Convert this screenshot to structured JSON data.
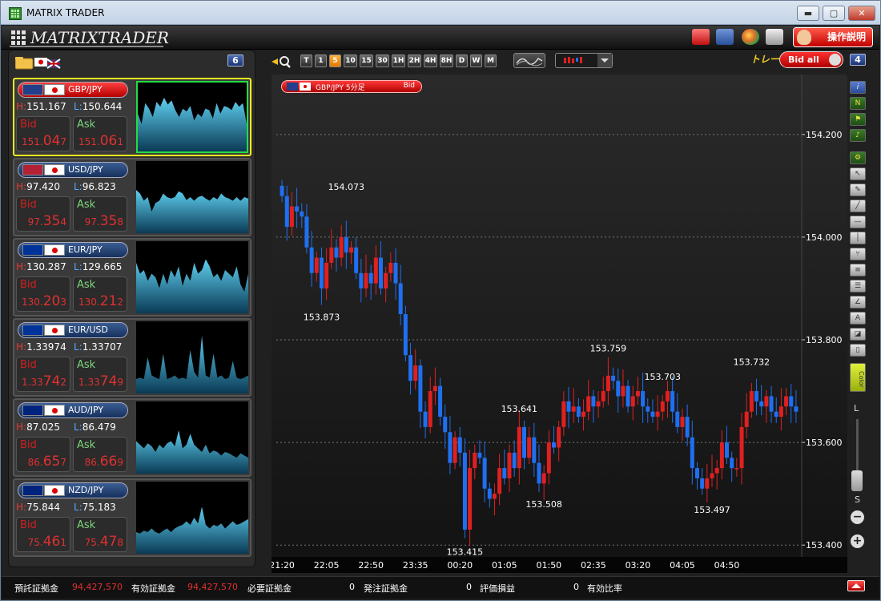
{
  "window": {
    "title": "MATRIX TRADER",
    "minimize": "▬",
    "maximize": "▢",
    "close": "✕"
  },
  "header": {
    "logo": "MATRIXTRADER",
    "help_label": "操作説明"
  },
  "left_panel": {
    "pair_count": "6"
  },
  "pairs": [
    {
      "name": "GBP/JPY",
      "high": "151.167",
      "low": "150.644",
      "bid_label": "Bid",
      "ask_label": "Ask",
      "bid_pre": "151.",
      "bid_big": "04",
      "bid_post": "7",
      "ask_pre": "151.",
      "ask_big": "06",
      "ask_post": "1",
      "f1": "#233e8a",
      "spark": [
        0.55,
        0.4,
        0.7,
        0.62,
        0.5,
        0.72,
        0.65,
        0.78,
        0.68,
        0.74,
        0.6,
        0.5,
        0.62,
        0.58,
        0.66,
        0.45,
        0.55,
        0.5,
        0.62,
        0.6,
        0.48,
        0.7,
        0.55,
        0.66,
        0.64,
        0.6,
        0.72,
        0.65,
        0.7,
        0.4
      ]
    },
    {
      "name": "USD/JPY",
      "high": "97.420",
      "low": "96.823",
      "bid_label": "Bid",
      "ask_label": "Ask",
      "bid_pre": "97.",
      "bid_big": "35",
      "bid_post": "4",
      "ask_pre": "97.",
      "ask_big": "35",
      "ask_post": "8",
      "f1": "#b22234",
      "spark": [
        0.6,
        0.55,
        0.45,
        0.5,
        0.3,
        0.42,
        0.45,
        0.55,
        0.5,
        0.48,
        0.5,
        0.58,
        0.55,
        0.46,
        0.5,
        0.45,
        0.5,
        0.52,
        0.48,
        0.45,
        0.5,
        0.47,
        0.55,
        0.5,
        0.48,
        0.45,
        0.5,
        0.45,
        0.5,
        0.48
      ]
    },
    {
      "name": "EUR/JPY",
      "high": "130.287",
      "low": "129.665",
      "bid_label": "Bid",
      "ask_label": "Ask",
      "bid_pre": "130.",
      "bid_big": "20",
      "bid_post": "3",
      "ask_pre": "130.",
      "ask_big": "21",
      "ask_post": "2",
      "f1": "#003399",
      "spark": [
        0.7,
        0.55,
        0.6,
        0.45,
        0.55,
        0.5,
        0.35,
        0.55,
        0.4,
        0.6,
        0.5,
        0.65,
        0.38,
        0.55,
        0.45,
        0.7,
        0.55,
        0.6,
        0.75,
        0.65,
        0.5,
        0.55,
        0.45,
        0.6,
        0.55,
        0.5,
        0.65,
        0.4,
        0.3,
        0.55
      ]
    },
    {
      "name": "EUR/USD",
      "high": "1.33974",
      "low": "1.33707",
      "bid_label": "Bid",
      "ask_label": "Ask",
      "bid_pre": "1.33",
      "bid_big": "74",
      "bid_post": "2",
      "ask_pre": "1.33",
      "ask_big": "74",
      "ask_post": "9",
      "f1": "#003399",
      "spark": [
        0.2,
        0.22,
        0.2,
        0.5,
        0.25,
        0.22,
        0.2,
        0.55,
        0.2,
        0.22,
        0.25,
        0.2,
        0.22,
        0.2,
        0.6,
        0.3,
        0.22,
        0.8,
        0.25,
        0.22,
        0.55,
        0.22,
        0.25,
        0.2,
        0.22,
        0.45,
        0.22,
        0.2,
        0.22,
        0.25
      ]
    },
    {
      "name": "AUD/JPY",
      "high": "87.025",
      "low": "86.479",
      "bid_label": "Bid",
      "ask_label": "Ask",
      "bid_pre": "86.",
      "bid_big": "65",
      "bid_post": "7",
      "ask_pre": "86.",
      "ask_big": "66",
      "ask_post": "9",
      "f1": "#00247d",
      "spark": [
        0.45,
        0.4,
        0.35,
        0.42,
        0.38,
        0.3,
        0.4,
        0.35,
        0.42,
        0.45,
        0.38,
        0.6,
        0.35,
        0.4,
        0.55,
        0.4,
        0.35,
        0.3,
        0.4,
        0.28,
        0.32,
        0.3,
        0.25,
        0.3,
        0.28,
        0.25,
        0.22,
        0.28,
        0.25,
        0.22
      ]
    },
    {
      "name": "NZD/JPY",
      "high": "75.844",
      "low": "75.183",
      "bid_label": "Bid",
      "ask_label": "Ask",
      "bid_pre": "75.",
      "bid_big": "46",
      "bid_post": "1",
      "ask_pre": "75.",
      "ask_big": "47",
      "ask_post": "8",
      "f1": "#00247d",
      "spark": [
        0.3,
        0.28,
        0.32,
        0.3,
        0.35,
        0.3,
        0.28,
        0.32,
        0.35,
        0.3,
        0.35,
        0.38,
        0.4,
        0.45,
        0.4,
        0.5,
        0.42,
        0.65,
        0.4,
        0.35,
        0.4,
        0.38,
        0.42,
        0.35,
        0.4,
        0.45,
        0.4,
        0.42,
        0.45,
        0.48
      ]
    }
  ],
  "toolbar": {
    "timeframes": [
      "T",
      "1",
      "5",
      "10",
      "15",
      "30",
      "1H",
      "2H",
      "4H",
      "8H",
      "D",
      "W",
      "M"
    ],
    "active_timeframe": "5",
    "trade_label": "トレード",
    "bid_all_label": "Bid all",
    "chart_count": "4"
  },
  "chart_label": {
    "pair": "GBP/JPY 5分足",
    "side": "Bid"
  },
  "chart_data": {
    "type": "candlestick",
    "title": "GBP/JPY 5分足",
    "y_ticks": [
      "154.200",
      "154.000",
      "153.800",
      "153.600",
      "153.400"
    ],
    "y_tick_values": [
      154.2,
      154.0,
      153.8,
      153.6,
      153.4
    ],
    "ylim": [
      153.38,
      154.27
    ],
    "x_ticks": [
      "21:20",
      "22:05",
      "22:50",
      "23:35",
      "00:20",
      "01:05",
      "01:50",
      "02:35",
      "03:20",
      "04:05",
      "04:50"
    ],
    "annotations": [
      {
        "label": "154.073",
        "value": 154.073,
        "index": 13
      },
      {
        "label": "153.873",
        "value": 153.873,
        "index": 8
      },
      {
        "label": "153.641",
        "value": 153.641,
        "index": 48
      },
      {
        "label": "153.508",
        "value": 153.508,
        "index": 53
      },
      {
        "label": "153.415",
        "value": 153.415,
        "index": 37
      },
      {
        "label": "153.759",
        "value": 153.759,
        "index": 66
      },
      {
        "label": "153.703",
        "value": 153.703,
        "index": 77
      },
      {
        "label": "153.497",
        "value": 153.497,
        "index": 87
      },
      {
        "label": "153.732",
        "value": 153.732,
        "index": 95
      }
    ],
    "up_color": "#e02020",
    "down_color": "#1f6ff0",
    "closes": [
      154.08,
      154.02,
      154.06,
      154.05,
      154.04,
      153.98,
      153.93,
      153.96,
      153.9,
      153.95,
      153.98,
      153.96,
      154.0,
      153.97,
      153.98,
      153.93,
      153.9,
      153.93,
      153.91,
      153.96,
      153.9,
      153.93,
      153.95,
      153.91,
      153.85,
      153.77,
      153.72,
      153.75,
      153.66,
      153.63,
      153.7,
      153.71,
      153.65,
      153.62,
      153.56,
      153.61,
      153.58,
      153.43,
      153.55,
      153.58,
      153.57,
      153.51,
      153.49,
      153.5,
      153.55,
      153.53,
      153.58,
      153.55,
      153.63,
      153.57,
      153.61,
      153.56,
      153.52,
      153.54,
      153.6,
      153.59,
      153.63,
      153.68,
      153.66,
      153.67,
      153.65,
      153.66,
      153.69,
      153.67,
      153.68,
      153.7,
      153.73,
      153.72,
      153.69,
      153.71,
      153.67,
      153.69,
      153.7,
      153.67,
      153.66,
      153.65,
      153.66,
      153.68,
      153.7,
      153.66,
      153.63,
      153.65,
      153.61,
      153.55,
      153.53,
      153.51,
      153.53,
      153.54,
      153.55,
      153.6,
      153.57,
      153.55,
      153.55,
      153.63,
      153.66,
      153.7,
      153.68,
      153.67,
      153.69,
      153.66,
      153.65,
      153.67,
      153.69,
      153.67,
      153.66
    ]
  },
  "status": {
    "deposit_label": "預託証拠金",
    "deposit": "94,427,570",
    "effective_label": "有効証拠金",
    "effective": "94,427,570",
    "required_label": "必要証拠金",
    "required": "0",
    "order_label": "発注証拠金",
    "order": "0",
    "pnl_label": "評価損益",
    "pnl": "0",
    "ratio_label": "有効比率"
  },
  "rtools": {
    "L": "L",
    "S": "S",
    "color": "Color"
  }
}
